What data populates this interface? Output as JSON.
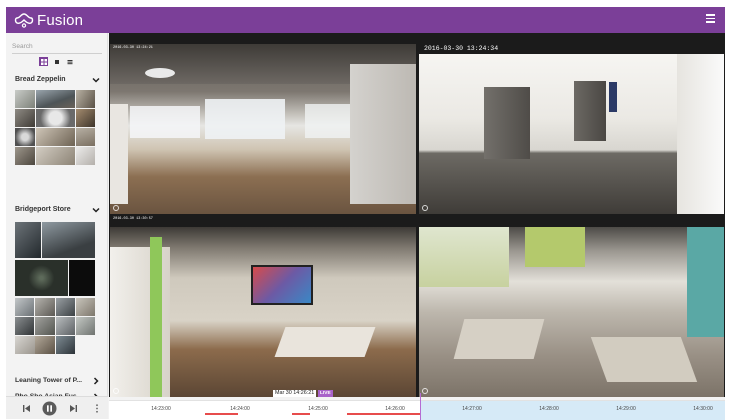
{
  "app": {
    "name": "Fusion",
    "brand_color": "#7b3f98"
  },
  "header": {
    "menu_icon": "hamburger-menu-icon"
  },
  "sidebar": {
    "search_placeholder": "Search",
    "view_modes": [
      "grid-view",
      "single-view",
      "list-view"
    ],
    "active_view": "grid-view",
    "groups": [
      {
        "name": "Bread Zeppelin",
        "expanded": true,
        "thumbnail_count": 12
      },
      {
        "name": "Bridgeport Store",
        "expanded": true,
        "thumbnail_count": 13
      },
      {
        "name": "Leaning Tower of P...",
        "expanded": false
      },
      {
        "name": "Pho Sho Asian Fus...",
        "expanded": false
      }
    ]
  },
  "cameras": [
    {
      "timestamp": "2016-03-30 13:24:21"
    },
    {
      "timestamp": "2016-03-30 13:24:34"
    },
    {
      "timestamp": "2016-03-30 13:30:57"
    },
    {
      "timestamp": ""
    }
  ],
  "timeline": {
    "current_time_label": "Mar 30  14:26:21",
    "live_label": "LIVE",
    "ticks": [
      "14:23:00",
      "14:24:00",
      "14:25:00",
      "14:26:00",
      "14:27:00",
      "14:28:00",
      "14:29:00",
      "14:30:00"
    ],
    "recording_color": "#e74c4c",
    "live_zone_color": "#d6eaf7"
  },
  "controls": [
    "skip-back-icon",
    "pause-icon",
    "skip-forward-icon",
    "more-options-icon"
  ]
}
